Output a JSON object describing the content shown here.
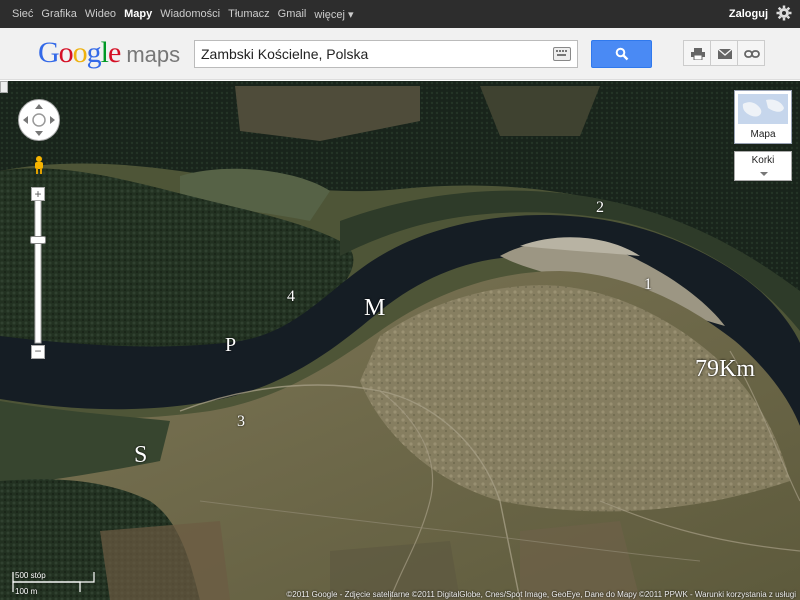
{
  "topbar": {
    "nav": [
      "Sieć",
      "Grafika",
      "Wideo",
      "Mapy",
      "Wiadomości",
      "Tłumacz",
      "Gmail",
      "więcej ▾"
    ],
    "active_index": 3,
    "login": "Zaloguj"
  },
  "header": {
    "logo_google": "Google",
    "logo_maps": "maps",
    "search_value": "Zambski Kościelne, Polska"
  },
  "map": {
    "labels": {
      "n1": "1",
      "n2": "2",
      "n3": "3",
      "n4": "4",
      "M": "M",
      "P": "P",
      "S": "S",
      "km": "79Km"
    },
    "maptype_label": "Mapa",
    "korki_label": "Korki",
    "scale_ft": "500 stóp",
    "scale_m": "100 m",
    "copyright": "©2011 Google - Zdjęcie satelitarne ©2011 DigitalGlobe, Cnes/Spot Image, GeoEye, Dane do Mapy ©2011 PPWK - Warunki korzystania z usługi"
  },
  "colors": {
    "topbar": "#2d2d2d",
    "search_button": "#4a8af4",
    "river": "#151d24",
    "forest": "#243322",
    "meadow": "#6b6645"
  },
  "icons": [
    "gear-icon",
    "keyboard-icon",
    "search-icon",
    "print-icon",
    "email-icon",
    "link-icon",
    "pan-control-icon",
    "pegman-icon",
    "zoom-in-icon",
    "zoom-out-icon"
  ]
}
